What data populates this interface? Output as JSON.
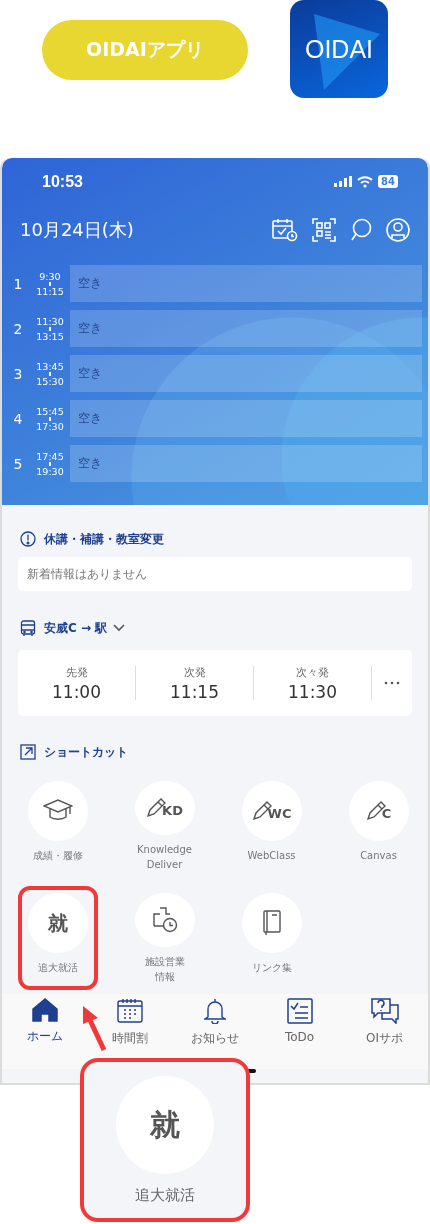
{
  "promo": {
    "pill_label": "OIDAIアプリ",
    "app_icon_text": "OIDAI"
  },
  "status_bar": {
    "time": "10:53",
    "battery": "84"
  },
  "header": {
    "date": "10月24日(木)"
  },
  "periods": [
    {
      "number": "1",
      "start": "9:30",
      "end": "11:15",
      "status": "空き"
    },
    {
      "number": "2",
      "start": "11:30",
      "end": "13:15",
      "status": "空き"
    },
    {
      "number": "3",
      "start": "13:45",
      "end": "15:30",
      "status": "空き"
    },
    {
      "number": "4",
      "start": "15:45",
      "end": "17:30",
      "status": "空き"
    },
    {
      "number": "5",
      "start": "17:45",
      "end": "19:30",
      "status": "空き"
    }
  ],
  "notices": {
    "title": "休講・補講・教室変更",
    "message": "新着情報はありません"
  },
  "bus": {
    "route": "安威C → 駅",
    "departures": [
      {
        "label": "先発",
        "time": "11:00"
      },
      {
        "label": "次発",
        "time": "11:15"
      },
      {
        "label": "次々発",
        "time": "11:30"
      }
    ]
  },
  "shortcuts": {
    "title": "ショートカット",
    "items": [
      {
        "kind": "cap",
        "label": "成績・履修",
        "highlighted": false
      },
      {
        "kind": "pencil",
        "badge": "KD",
        "label": "Knowledge\nDeliver",
        "highlighted": false
      },
      {
        "kind": "pencil",
        "badge": "WC",
        "label": "WebClass",
        "highlighted": false
      },
      {
        "kind": "pencil",
        "badge": "C",
        "label": "Canvas",
        "highlighted": false
      },
      {
        "kind": "char",
        "badge": "就",
        "label": "追大就活",
        "highlighted": true
      },
      {
        "kind": "facility",
        "label": "施設営業",
        "label_line_2": "情報",
        "highlighted": false
      },
      {
        "kind": "notebook",
        "label": "リンク集",
        "highlighted": false
      }
    ]
  },
  "tabs": [
    {
      "kind": "home",
      "label": "ホーム",
      "selected": true
    },
    {
      "kind": "calendar",
      "label": "時間割",
      "selected": false
    },
    {
      "kind": "bell",
      "label": "お知らせ",
      "selected": false
    },
    {
      "kind": "todo",
      "label": "ToDo",
      "selected": false
    },
    {
      "kind": "help",
      "label": "OIサポ",
      "selected": false
    }
  ],
  "callout": {
    "icon_text": "就",
    "label": "追大就活"
  }
}
